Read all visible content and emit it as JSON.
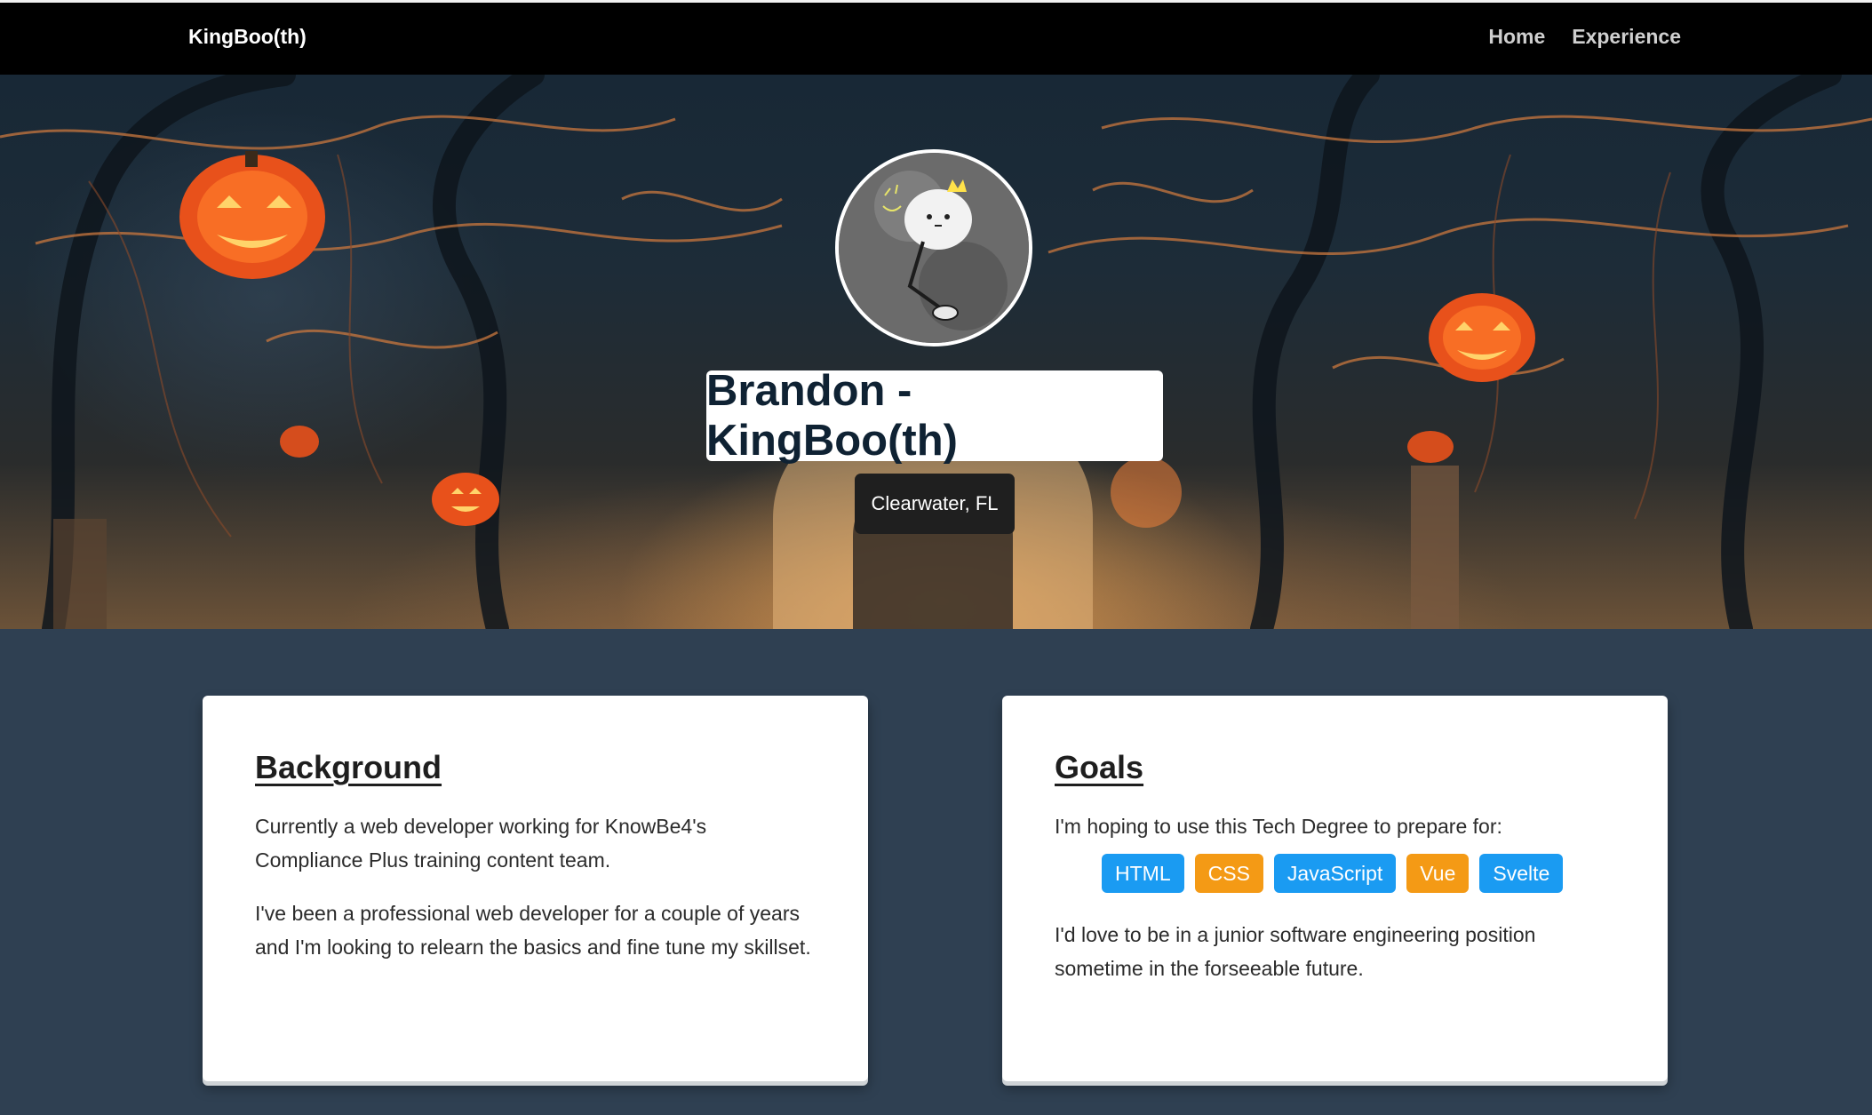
{
  "nav": {
    "brand": "KingBoo(th)",
    "links": [
      {
        "label": "Home"
      },
      {
        "label": "Experience"
      }
    ]
  },
  "hero": {
    "avatar_icon": "ghost-king-avatar",
    "title": "Brandon - KingBoo(th)",
    "location": "Clearwater, FL"
  },
  "background_card": {
    "heading": "Background",
    "paragraphs": [
      "Currently a web developer working for KnowBe4's Compliance Plus training content team.",
      "I've been a professional web developer for a couple of years and I'm looking to relearn the basics and fine tune my skillset."
    ]
  },
  "goals_card": {
    "heading": "Goals",
    "intro": "I'm hoping to use this Tech Degree to prepare for:",
    "tags": [
      {
        "label": "HTML",
        "color": "#1a9bf2"
      },
      {
        "label": "CSS",
        "color": "#f49a15"
      },
      {
        "label": "JavaScript",
        "color": "#1a9bf2"
      },
      {
        "label": "Vue",
        "color": "#f49a15"
      },
      {
        "label": "Svelte",
        "color": "#1a9bf2"
      }
    ],
    "outro": "I'd love to be in a junior software engineering position sometime in the forseeable future."
  },
  "colors": {
    "page_background": "#2f4052",
    "navbar": "#000000",
    "tag_blue": "#1a9bf2",
    "tag_orange": "#f49a15",
    "title_text": "#0f2233"
  }
}
